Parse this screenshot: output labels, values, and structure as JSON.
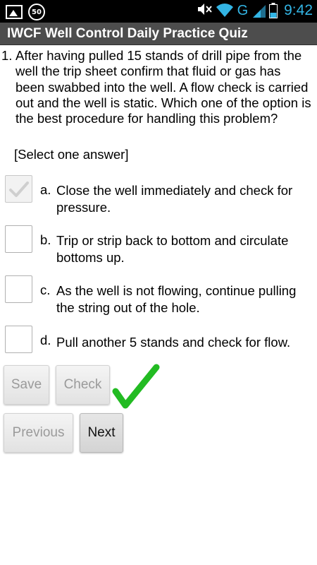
{
  "status_bar": {
    "badge": "50",
    "network": "G",
    "time": "9:42"
  },
  "app": {
    "title": "IWCF Well Control Daily Practice Quiz"
  },
  "question": {
    "number": "1.",
    "text": "After having pulled 15 stands of drill pipe from the well the trip sheet confirm that fluid or gas has been swabbed into the well. A flow check is carried out and the well is static. Which one of the option is the best procedure for handling this problem?",
    "hint": "[Select one answer]"
  },
  "options": [
    {
      "letter": "a.",
      "text": "Close the well immediately and check for pressure.",
      "checked": true
    },
    {
      "letter": "b.",
      "text": "Trip or strip back to bottom and circulate bottoms up.",
      "checked": false
    },
    {
      "letter": "c.",
      "text": "As the well is not flowing, continue pulling the string out of the hole.",
      "checked": false
    },
    {
      "letter": "d.",
      "text": "Pull another 5 stands and check for flow.",
      "checked": false
    }
  ],
  "buttons": {
    "save": "Save",
    "check": "Check",
    "previous": "Previous",
    "next": "Next"
  },
  "result_icon": "green-checkmark-icon",
  "colors": {
    "status_accent": "#33b5e5",
    "title_bar": "#4d4d4d",
    "correct": "#22bb22"
  }
}
